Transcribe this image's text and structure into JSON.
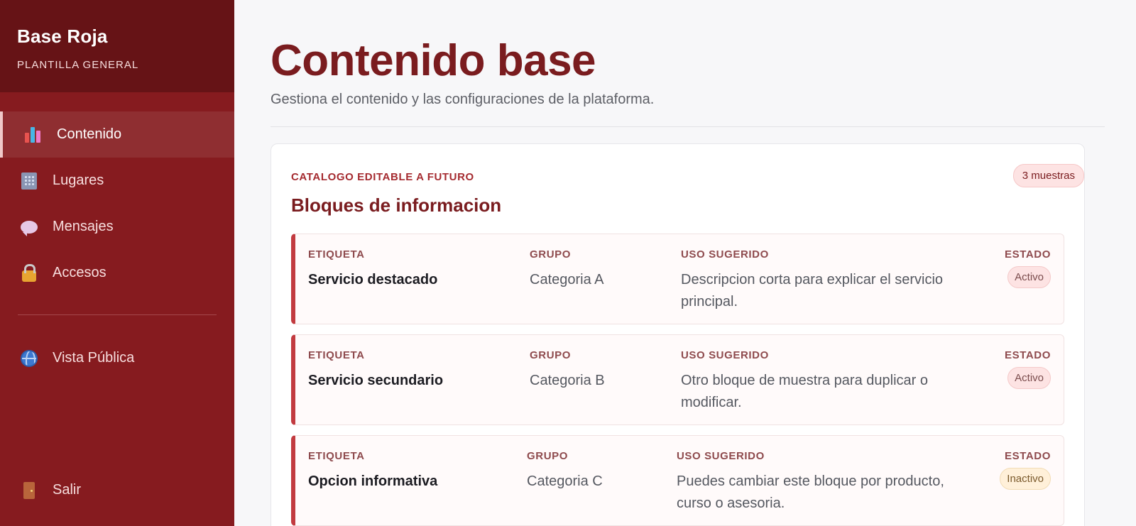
{
  "sidebar": {
    "brand_title": "Base Roja",
    "brand_subtitle": "PLANTILLA GENERAL",
    "items": [
      {
        "label": "Contenido",
        "icon": "bar-chart-icon",
        "active": true
      },
      {
        "label": "Lugares",
        "icon": "building-icon",
        "active": false
      },
      {
        "label": "Mensajes",
        "icon": "speech-bubble-icon",
        "active": false
      },
      {
        "label": "Accesos",
        "icon": "lock-icon",
        "active": false
      }
    ],
    "public_view": {
      "label": "Vista Pública",
      "icon": "globe-icon"
    },
    "exit": {
      "label": "Salir",
      "icon": "door-icon"
    }
  },
  "main": {
    "title": "Contenido base",
    "subtitle": "Gestiona el contenido y las configuraciones de la plataforma."
  },
  "card": {
    "eyebrow": "CATALOGO EDITABLE A FUTURO",
    "title": "Bloques de informacion",
    "count_badge": "3 muestras",
    "columns": {
      "label": "ETIQUETA",
      "group": "GRUPO",
      "usage": "USO SUGERIDO",
      "status": "ESTADO"
    },
    "rows": [
      {
        "label": "Servicio destacado",
        "group": "Categoria A",
        "usage": "Descripcion corta para explicar el servicio principal.",
        "status": "Activo"
      },
      {
        "label": "Servicio secundario",
        "group": "Categoria B",
        "usage": "Otro bloque de muestra para duplicar o modificar.",
        "status": "Activo"
      },
      {
        "label": "Opcion informativa",
        "group": "Categoria C",
        "usage": "Puedes cambiar este bloque por producto, curso o asesoria.",
        "status": "Inactivo"
      }
    ]
  },
  "colors": {
    "sidebar_bg": "#861b1f",
    "brand_bg": "#661316",
    "accent": "#7a1c1f",
    "row_border": "#c23b40"
  }
}
